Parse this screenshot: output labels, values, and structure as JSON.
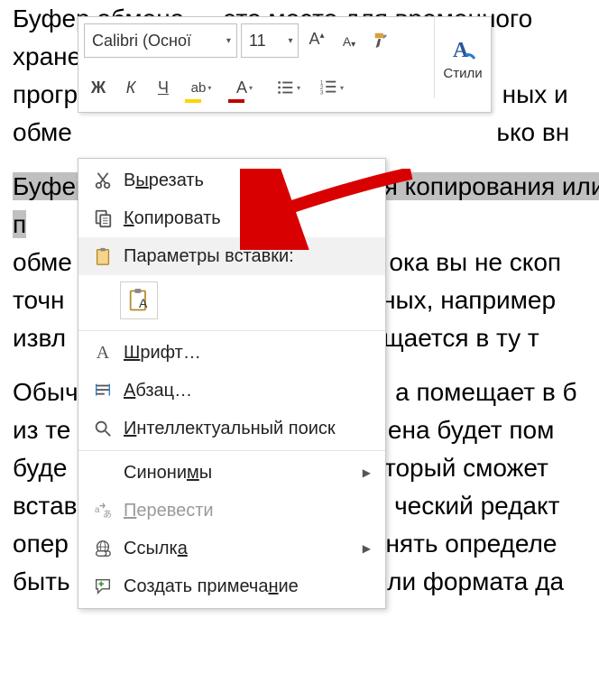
{
  "doc": {
    "line1": "Буфер обмена — это место для временного хранени",
    "line2": "прогр",
    "line2b": "ных и",
    "line3": "обме",
    "line3b": "ько вн",
    "highlighted": "Буфер обмена используется для копирования или п",
    "line5": "обме",
    "line5b": "ока вы не скоп",
    "line6": "точн",
    "line6b": "ных, например",
    "line7": "извл",
    "line7b": "щается в ту т",
    "p2l1": "Обыч",
    "p2l1b": "а помещает в б",
    "p2l2": "из те",
    "p2l2b": "ена будет пом",
    "p2l3": "буде",
    "p2l3b": "торый сможет",
    "p2l4": "встав",
    "p2l4b": "ческий редакт",
    "p2l5": "опер",
    "p2l5b": "нять определе",
    "p2l6": "быть",
    "p2l6b": "ли формата да"
  },
  "toolbar": {
    "font_name": "Calibri (Осної",
    "font_size": "11",
    "styles_label": "Стили"
  },
  "context_menu": {
    "cut": "Вырезать",
    "copy": "Копировать",
    "paste_options_header": "Параметры вставки:",
    "font": "Шрифт…",
    "paragraph": "Абзац…",
    "smart_lookup": "Интеллектуальный поиск",
    "synonyms": "Синонимы",
    "translate": "Перевести",
    "link": "Ссылка",
    "new_comment": "Создать примечание"
  }
}
